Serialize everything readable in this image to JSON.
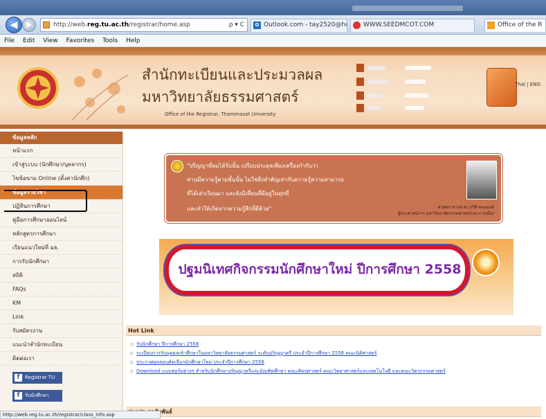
{
  "browser": {
    "address_scheme": "http://web.",
    "address_host": "reg.tu.ac.th",
    "address_path": "/registrar/home.asp",
    "address_actions": "ρ ▾ C",
    "tabs": [
      {
        "label": "Outlook.com - tay2520@hotm...",
        "icon": "outlook-icon"
      },
      {
        "label": "WWW.SEEDMCOT.COM",
        "icon": "site-favicon"
      },
      {
        "label": "Office of the R",
        "icon": "page-favicon"
      }
    ],
    "menu": [
      "File",
      "Edit",
      "View",
      "Favorites",
      "Tools",
      "Help"
    ],
    "status_url": "http://web.reg.tu.ac.th/registrar/class_info.asp"
  },
  "header": {
    "title_line1": "สำนักทะเบียนและประมวลผล",
    "title_line2": "มหาวิทยาลัยธรรมศาสตร์",
    "subtitle": "Office of the Registrar, Thammasat University",
    "lang": "Thai | ENG",
    "brand_color": "#b9652f"
  },
  "sidebar": {
    "heading": "ข้อมูลหลัก",
    "items": [
      {
        "label": "หน้าแรก"
      },
      {
        "label": "เข้าสู่ระบบ (นักศึกษา/บุคลากร)"
      },
      {
        "label": "ไขข้อขาม Online (ตั้งค่านักศึก)"
      },
      {
        "label": "ข้อมูลรายวิชา"
      },
      {
        "label": "ปฏิทินการศึกษา"
      },
      {
        "label": "คู่มือการศึกษาออนไลน์"
      },
      {
        "label": "หลักสูตรการศึกษา"
      },
      {
        "label": "เรียนแนวใหม่ที่ มธ."
      },
      {
        "label": "การรับนักศึกษา"
      },
      {
        "label": "สถิติ"
      },
      {
        "label": "FAQs"
      },
      {
        "label": "KM"
      },
      {
        "label": "Link"
      },
      {
        "label": "รับสมัครงาน"
      },
      {
        "label": "แนะนำสำนักทะเบียน"
      },
      {
        "label": "ติดต่อเรา"
      }
    ],
    "active_index": 3,
    "buttons": [
      {
        "label": "Registrar TU"
      },
      {
        "label": "รับนักศึกษา"
      }
    ]
  },
  "main": {
    "quote_lines": [
      "\"ปริญญาที่ผมได้รับนั้น เปรียบประดุจเพียงเครื่องกำกับว่า",
      "ท่านมีความรู้ตามขั้นนั้น ไม่ใช่สิ่งสำคัญเท่ากับความรู้ความสามารถ",
      "ที่ได้เล่าเรียนมา และยังมีเพื่อนที่ดีอยู่ในทุกที่",
      "และทำให้เกิดจากความรู้สึกที่ดีด้วย\""
    ],
    "quote_attrib_1": "ศาสตราจารย์ ดร.ปรีดี พนมยงค์",
    "quote_attrib_2": "ผู้ประศาสน์การ มหาวิทยาลัยธรรมศาสตร์และการเมือง",
    "banner_text": "ปฐมนิเทศกิจกรรมนักศึกษาใหม่ ปีการศึกษา 2558",
    "hot_link_heading": "Hot Link",
    "hot_links": [
      "รับนักศึกษา ปีการศึกษา 2558",
      "ระเบียบการรับบุคคลเข้าศึกษาในมหาวิทยาลัยธรรมศาสตร์ ระดับปริญญาตรี ประจำปีการศึกษา 2558 คณะนิติศาสตร์",
      "ประกาศผลสอบคัดเลือกนักศึกษาใหม่ ประจำปีการศึกษา 2558",
      "Download แบบฟอร์มต่างๆ สำหรับนักศึกษาปริญญาตรีและบัณฑิตศึกษา คณะศิลปศาสตร์ คณะวิทยาศาสตร์และเทคโนโลยี และคณะวิศวกรรมศาสตร์"
    ],
    "news_heading": "ข่าวประชาสัมพันธ์"
  }
}
